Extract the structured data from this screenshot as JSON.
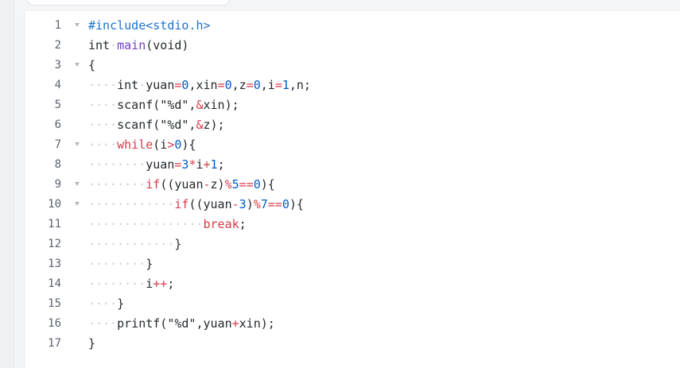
{
  "editor": {
    "lines": [
      {
        "num": "1",
        "fold": true,
        "tokens": [
          {
            "t": "#include<stdio.h>",
            "c": "kw-pre"
          }
        ]
      },
      {
        "num": "2",
        "fold": false,
        "tokens": [
          {
            "t": "int",
            "c": "kw"
          },
          {
            "t": "·",
            "c": "ws"
          },
          {
            "t": "main",
            "c": "fn"
          },
          {
            "t": "(void)",
            "c": "kw"
          }
        ]
      },
      {
        "num": "3",
        "fold": true,
        "tokens": [
          {
            "t": "{",
            "c": "kw"
          }
        ]
      },
      {
        "num": "4",
        "fold": false,
        "tokens": [
          {
            "t": "····",
            "c": "ws"
          },
          {
            "t": "int",
            "c": "kw"
          },
          {
            "t": "·",
            "c": "ws"
          },
          {
            "t": "yuan",
            "c": "kw"
          },
          {
            "t": "=",
            "c": "op"
          },
          {
            "t": "0",
            "c": "num"
          },
          {
            "t": ",xin",
            "c": "kw"
          },
          {
            "t": "=",
            "c": "op"
          },
          {
            "t": "0",
            "c": "num"
          },
          {
            "t": ",z",
            "c": "kw"
          },
          {
            "t": "=",
            "c": "op"
          },
          {
            "t": "0",
            "c": "num"
          },
          {
            "t": ",i",
            "c": "kw"
          },
          {
            "t": "=",
            "c": "op"
          },
          {
            "t": "1",
            "c": "num"
          },
          {
            "t": ",n;",
            "c": "kw"
          }
        ]
      },
      {
        "num": "5",
        "fold": false,
        "tokens": [
          {
            "t": "····",
            "c": "ws"
          },
          {
            "t": "scanf(\"%d\",",
            "c": "kw"
          },
          {
            "t": "&",
            "c": "amp"
          },
          {
            "t": "xin);",
            "c": "kw"
          }
        ]
      },
      {
        "num": "6",
        "fold": false,
        "tokens": [
          {
            "t": "····",
            "c": "ws"
          },
          {
            "t": "scanf(\"%d\",",
            "c": "kw"
          },
          {
            "t": "&",
            "c": "amp"
          },
          {
            "t": "z);",
            "c": "kw"
          }
        ]
      },
      {
        "num": "7",
        "fold": true,
        "tokens": [
          {
            "t": "····",
            "c": "ws"
          },
          {
            "t": "while",
            "c": "kw2"
          },
          {
            "t": "(i",
            "c": "kw"
          },
          {
            "t": ">",
            "c": "op"
          },
          {
            "t": "0",
            "c": "num"
          },
          {
            "t": "){",
            "c": "kw"
          }
        ]
      },
      {
        "num": "8",
        "fold": false,
        "tokens": [
          {
            "t": "········",
            "c": "ws"
          },
          {
            "t": "yuan",
            "c": "kw"
          },
          {
            "t": "=",
            "c": "op"
          },
          {
            "t": "3",
            "c": "num"
          },
          {
            "t": "*",
            "c": "op"
          },
          {
            "t": "i",
            "c": "kw"
          },
          {
            "t": "+",
            "c": "op"
          },
          {
            "t": "1",
            "c": "num"
          },
          {
            "t": ";",
            "c": "kw"
          }
        ]
      },
      {
        "num": "9",
        "fold": true,
        "tokens": [
          {
            "t": "········",
            "c": "ws"
          },
          {
            "t": "if",
            "c": "kw2"
          },
          {
            "t": "((yuan",
            "c": "kw"
          },
          {
            "t": "-",
            "c": "op"
          },
          {
            "t": "z)",
            "c": "kw"
          },
          {
            "t": "%",
            "c": "op"
          },
          {
            "t": "5",
            "c": "num"
          },
          {
            "t": "==",
            "c": "op"
          },
          {
            "t": "0",
            "c": "num"
          },
          {
            "t": "){",
            "c": "kw"
          }
        ]
      },
      {
        "num": "10",
        "fold": true,
        "tokens": [
          {
            "t": "············",
            "c": "ws"
          },
          {
            "t": "if",
            "c": "kw2"
          },
          {
            "t": "((yuan",
            "c": "kw"
          },
          {
            "t": "-",
            "c": "op"
          },
          {
            "t": "3",
            "c": "num"
          },
          {
            "t": ")",
            "c": "kw"
          },
          {
            "t": "%",
            "c": "op"
          },
          {
            "t": "7",
            "c": "num"
          },
          {
            "t": "==",
            "c": "op"
          },
          {
            "t": "0",
            "c": "num"
          },
          {
            "t": "){",
            "c": "kw"
          }
        ]
      },
      {
        "num": "11",
        "fold": false,
        "tokens": [
          {
            "t": "················",
            "c": "ws"
          },
          {
            "t": "break",
            "c": "kw2"
          },
          {
            "t": ";",
            "c": "kw"
          }
        ]
      },
      {
        "num": "12",
        "fold": false,
        "tokens": [
          {
            "t": "············",
            "c": "ws"
          },
          {
            "t": "}",
            "c": "kw"
          }
        ]
      },
      {
        "num": "13",
        "fold": false,
        "tokens": [
          {
            "t": "········",
            "c": "ws"
          },
          {
            "t": "}",
            "c": "kw"
          }
        ]
      },
      {
        "num": "14",
        "fold": false,
        "tokens": [
          {
            "t": "········",
            "c": "ws"
          },
          {
            "t": "i",
            "c": "kw"
          },
          {
            "t": "++",
            "c": "op"
          },
          {
            "t": ";",
            "c": "kw"
          }
        ]
      },
      {
        "num": "15",
        "fold": false,
        "tokens": [
          {
            "t": "····",
            "c": "ws"
          },
          {
            "t": "}",
            "c": "kw"
          }
        ]
      },
      {
        "num": "16",
        "fold": false,
        "tokens": [
          {
            "t": "····",
            "c": "ws"
          },
          {
            "t": "printf(\"%d\",yuan",
            "c": "kw"
          },
          {
            "t": "+",
            "c": "op"
          },
          {
            "t": "xin);",
            "c": "kw"
          }
        ]
      },
      {
        "num": "17",
        "fold": false,
        "tokens": [
          {
            "t": "}",
            "c": "kw"
          }
        ]
      }
    ]
  }
}
